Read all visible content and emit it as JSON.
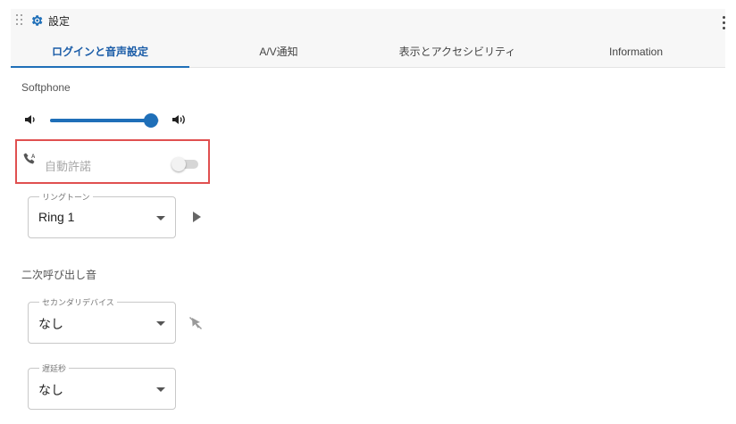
{
  "window": {
    "title": "設定",
    "title_icon": "gear-icon"
  },
  "tabs": [
    {
      "label": "ログインと音声設定",
      "active": true
    },
    {
      "label": "A/V通知",
      "active": false
    },
    {
      "label": "表示とアクセシビリティ",
      "active": false
    },
    {
      "label": "Information",
      "active": false
    }
  ],
  "softphone": {
    "section_label": "Softphone",
    "volume": {
      "level_fraction": 0.93
    },
    "auto_answer": {
      "label": "自動許諾",
      "enabled": false,
      "disabled": true
    },
    "ringtone": {
      "legend": "リングトーン",
      "value": "Ring 1"
    }
  },
  "secondary": {
    "section_label": "二次呼び出し音",
    "device": {
      "legend": "セカンダリデバイス",
      "value": "なし"
    },
    "delay": {
      "legend": "遅延秒",
      "value": "なし"
    }
  },
  "colors": {
    "accent": "#1f6fb8",
    "highlight_border": "#e05050"
  }
}
